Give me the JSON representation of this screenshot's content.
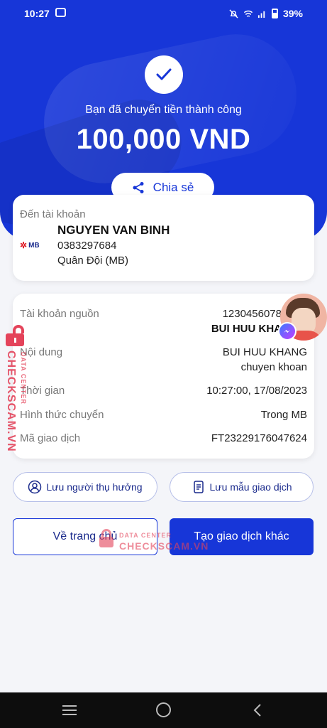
{
  "status_bar": {
    "time": "10:27",
    "battery": "39%"
  },
  "hero": {
    "success_text": "Bạn đã chuyển tiền thành công",
    "amount": "100,000 VND",
    "share_label": "Chia sẻ"
  },
  "destination": {
    "label": "Đến tài khoản",
    "bank_logo_text": "MB",
    "name": "NGUYEN VAN BINH",
    "account": "0383297684",
    "bank": "Quân Đội (MB)"
  },
  "details": {
    "source_label": "Tài khoản nguồn",
    "source_account": "1230456078",
    "source_name": "BUI HUU KHA",
    "content_label": "Nội dung",
    "content_line1": "BUI HUU KHANG",
    "content_line2": "chuyen khoan",
    "time_label": "Thời gian",
    "time_value": "10:27:00, 17/08/2023",
    "method_label": "Hình thức chuyển",
    "method_value": "Trong MB",
    "txn_label": "Mã giao dịch",
    "txn_value": "FT23229176047624"
  },
  "actions": {
    "save_beneficiary": "Lưu người thụ hưởng",
    "save_template": "Lưu mẫu giao dịch",
    "home": "Về trang chủ",
    "new_transaction": "Tạo giao dịch khác"
  },
  "watermark": {
    "brand": "CHECKSCAM.VN",
    "sub": "DATA CENTER"
  },
  "colors": {
    "primary": "#1736d8",
    "watermark": "#e4435a"
  }
}
